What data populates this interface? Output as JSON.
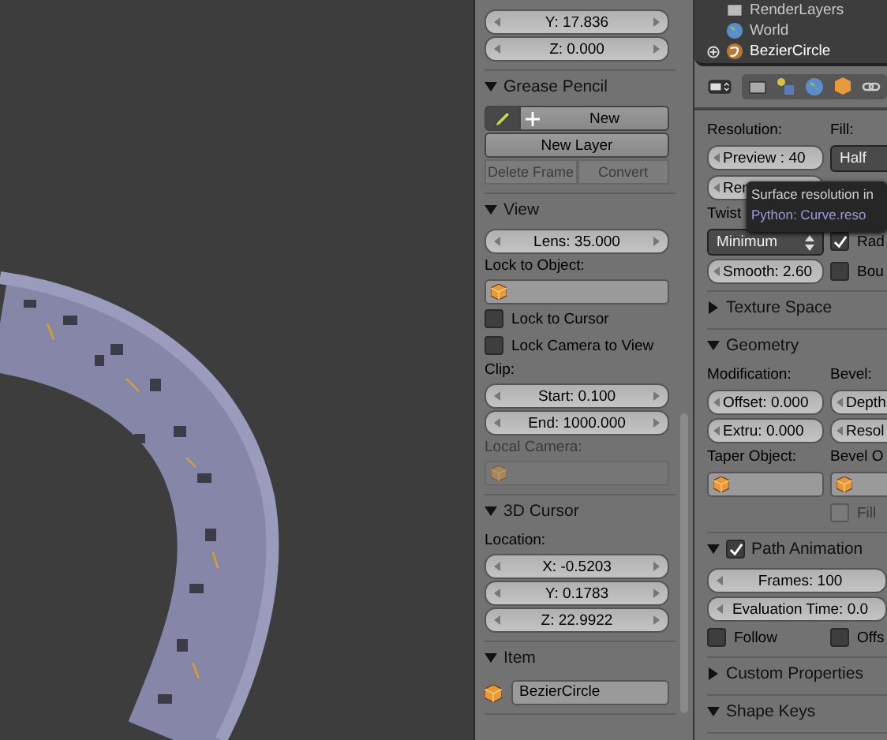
{
  "tool_shelf": {
    "sections": [
      {
        "items": [
          {
            "kind": "num",
            "text": "Y: 17.836"
          },
          {
            "kind": "num",
            "text": "Z: 0.000"
          }
        ]
      },
      {
        "title": "Grease Pencil",
        "expanded": true,
        "items": [
          {
            "kind": "gp",
            "text": "New"
          },
          {
            "kind": "button",
            "text": "New Layer"
          },
          {
            "kind": "pair",
            "disabled": true,
            "buttons": [
              "Delete Frame",
              "Convert"
            ]
          }
        ]
      },
      {
        "title": "View",
        "expanded": true,
        "items": [
          {
            "kind": "num",
            "text": "Lens: 35.000"
          },
          {
            "kind": "label",
            "text": "Lock to Object:",
            "disabled": false
          },
          {
            "kind": "object",
            "disabled": false
          },
          {
            "kind": "check",
            "text": "Lock to Cursor",
            "checked": false,
            "disabled": false
          },
          {
            "kind": "check",
            "text": "Lock Camera to View",
            "checked": false,
            "disabled": false
          },
          {
            "kind": "label",
            "text": "Clip:",
            "disabled": false
          },
          {
            "kind": "num",
            "text": "Start: 0.100"
          },
          {
            "kind": "num",
            "text": "End: 1000.000"
          },
          {
            "kind": "label",
            "text": "Local Camera:",
            "disabled": true
          },
          {
            "kind": "object",
            "disabled": true
          }
        ]
      },
      {
        "title": "3D Cursor",
        "expanded": true,
        "items": [
          {
            "kind": "label",
            "text": "Location:",
            "disabled": false
          },
          {
            "kind": "num",
            "text": "X: -0.5203"
          },
          {
            "kind": "num",
            "text": "Y: 0.1783"
          },
          {
            "kind": "num",
            "text": "Z: 22.9922"
          }
        ]
      },
      {
        "title": "Item",
        "expanded": true,
        "items": [
          {
            "kind": "named",
            "text": "BezierCircle"
          }
        ]
      }
    ]
  },
  "outliner": [
    {
      "label": "RenderLayers",
      "kind": "layers",
      "selected": false
    },
    {
      "label": "World",
      "kind": "world",
      "selected": false
    },
    {
      "label": "BezierCircle",
      "kind": "curve",
      "selected": true
    }
  ],
  "properties": {
    "sections": [
      {
        "items": [
          {
            "kind": "cols",
            "cells": [
              {
                "kind": "label",
                "text": "Resolution:"
              },
              {
                "kind": "label",
                "text": "Fill:"
              }
            ]
          },
          {
            "kind": "cols",
            "cells": [
              {
                "kind": "pill",
                "text": "Preview : 40"
              },
              {
                "kind": "menu",
                "text": "Half"
              }
            ]
          },
          {
            "kind": "cols",
            "cells": [
              {
                "kind": "pill",
                "text": "Ren"
              }
            ]
          },
          {
            "kind": "cols",
            "cells": [
              {
                "kind": "label",
                "text": "Twist"
              }
            ]
          },
          {
            "kind": "cols",
            "cells": [
              {
                "kind": "menu",
                "text": "Minimum"
              },
              {
                "kind": "check",
                "text": "Rad",
                "checked": true,
                "disabled": false
              }
            ]
          },
          {
            "kind": "cols",
            "cells": [
              {
                "kind": "pill",
                "text": "Smooth: 2.60"
              },
              {
                "kind": "check",
                "text": "Bou",
                "checked": false,
                "disabled": false
              }
            ]
          }
        ]
      },
      {
        "title": "Texture Space",
        "expanded": false
      },
      {
        "title": "Geometry",
        "expanded": true,
        "items": [
          {
            "kind": "cols",
            "cells": [
              {
                "kind": "label",
                "text": "Modification:"
              },
              {
                "kind": "label",
                "text": "Bevel:"
              }
            ]
          },
          {
            "kind": "cols",
            "cells": [
              {
                "kind": "pill",
                "text": "Offset: 0.000"
              },
              {
                "kind": "pill",
                "text": "Depth"
              }
            ]
          },
          {
            "kind": "cols",
            "cells": [
              {
                "kind": "pill",
                "text": "Extru: 0.000"
              },
              {
                "kind": "pill",
                "text": "Resol"
              }
            ]
          },
          {
            "kind": "cols",
            "cells": [
              {
                "kind": "label",
                "text": "Taper Object:"
              },
              {
                "kind": "label",
                "text": "Bevel O"
              }
            ]
          },
          {
            "kind": "cols",
            "cells": [
              {
                "kind": "object"
              },
              {
                "kind": "object"
              }
            ]
          },
          {
            "kind": "cols",
            "cells": [
              {
                "kind": "blank"
              },
              {
                "kind": "check",
                "text": "Fill",
                "checked": false,
                "disabled": true
              }
            ]
          }
        ]
      },
      {
        "title": "Path Animation",
        "expanded": true,
        "checkbox": true,
        "items": [
          {
            "kind": "num",
            "text": "Frames: 100"
          },
          {
            "kind": "num",
            "text": "Evaluation Time: 0.0"
          },
          {
            "kind": "cols",
            "cells": [
              {
                "kind": "check",
                "text": "Follow",
                "checked": false,
                "disabled": false
              },
              {
                "kind": "check",
                "text": "Offs",
                "checked": false,
                "disabled": false
              }
            ]
          }
        ]
      },
      {
        "title": "Custom Properties",
        "expanded": false
      },
      {
        "title": "Shape Keys",
        "expanded": true
      }
    ]
  },
  "tooltip": {
    "text": "Surface resolution in",
    "python": "Python: Curve.reso"
  }
}
